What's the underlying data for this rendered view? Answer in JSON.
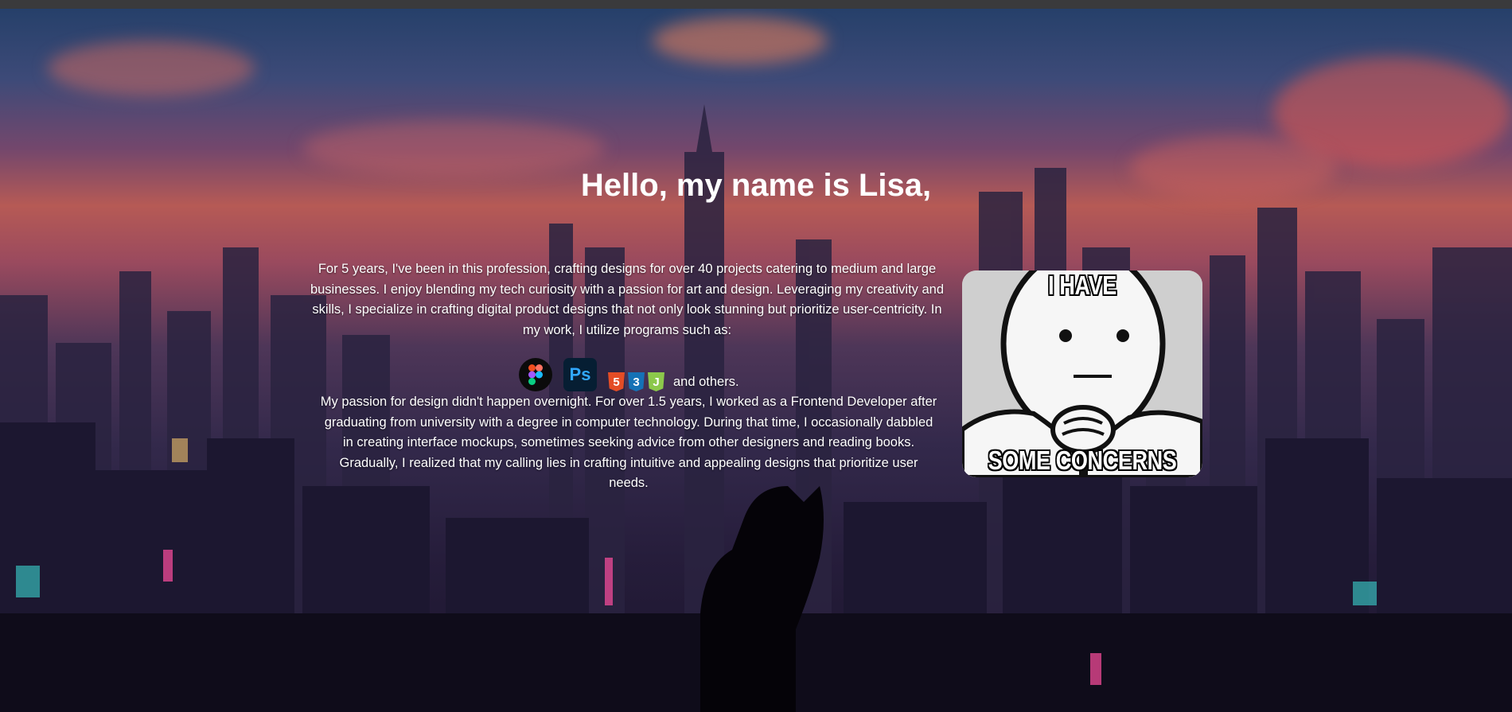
{
  "hero": {
    "title": "Hello, my name is Lisa,",
    "intro": "For 5 years, I've been in this profession, crafting designs for over 40 projects catering to medium and large businesses. I enjoy blending my tech curiosity with a passion for art and design. Leveraging my creativity and skills, I specialize in crafting digital product designs that not only look stunning but prioritize user-centricity. In my work, I utilize programs such as:",
    "tools": [
      {
        "icon": "figma-icon",
        "label": ""
      },
      {
        "icon": "photoshop-icon",
        "label": "Ps"
      },
      {
        "icon": "html-css-js-icons",
        "label": ""
      }
    ],
    "tools_suffix": "and others.",
    "story": "My passion for design didn't happen overnight. For over 1.5 years, I worked as a Frontend Developer after graduating from university with a degree in computer technology. During that time, I occasionally dabbled in creating interface mockups, sometimes seeking advice from other designers and reading books. Gradually, I realized that my calling lies in crafting intuitive and appealing designs that prioritize user needs."
  },
  "meme": {
    "top_text": "I HAVE",
    "bottom_text": "SOME CONCERNS"
  },
  "badges": {
    "html": "5",
    "css": "3",
    "js": "J"
  },
  "colors": {
    "html": "#e44d26",
    "css": "#1572b6",
    "js": "#8cc84b",
    "photoshop_bg": "#061e33",
    "photoshop_fg": "#31a8ff"
  }
}
